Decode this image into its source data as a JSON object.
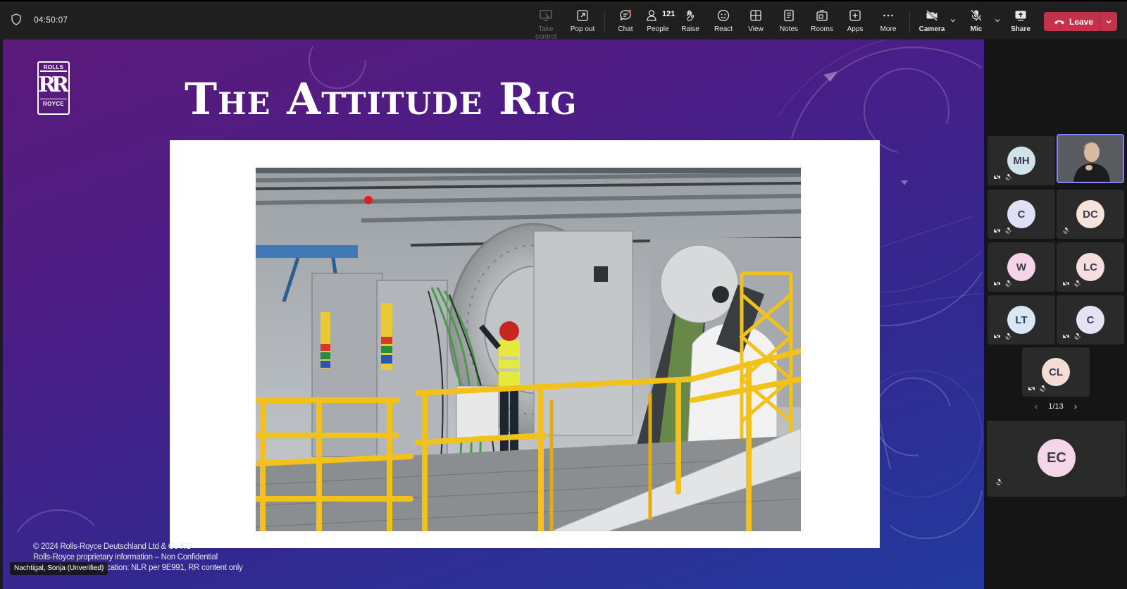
{
  "meeting": {
    "timer": "04:50:07"
  },
  "toolbar": {
    "take_control": "Take control",
    "pop_out": "Pop out",
    "chat": "Chat",
    "people": "People",
    "people_count": "121",
    "raise": "Raise",
    "react": "React",
    "view": "View",
    "notes": "Notes",
    "rooms": "Rooms",
    "apps": "Apps",
    "more": "More",
    "camera": "Camera",
    "mic": "Mic",
    "share": "Share",
    "leave": "Leave",
    "leave_color": "#c4314b"
  },
  "slide": {
    "logo_top": "ROLLS",
    "logo_mark": "RR",
    "logo_bottom": "ROYCE",
    "title": "The Attitude Rig",
    "footer": [
      "© 2024 Rolls-Royce Deutschland Ltd & Co KG",
      "Rolls-Royce proprietary information – Non Confidential",
      "Export Control classification: NLR per 9E991, RR content only"
    ],
    "presenter_label": "Nachtigal, Sonja (Unverified)"
  },
  "participants": {
    "tiles": [
      {
        "initials": "MH",
        "color": "#cfe3e8"
      },
      {
        "initials": "",
        "color": "#3a3a3a",
        "video": true
      },
      {
        "initials": "C",
        "color": "#e0e0f5"
      },
      {
        "initials": "DC",
        "color": "#f5e4dc"
      },
      {
        "initials": "W",
        "color": "#f6d3e9"
      },
      {
        "initials": "LC",
        "color": "#f6dede"
      },
      {
        "initials": "LT",
        "color": "#d8e6f6"
      },
      {
        "initials": "C",
        "color": "#e4e2f5"
      },
      {
        "initials": "CL",
        "color": "#f6dcd7"
      }
    ],
    "page": "1/13",
    "big_tile": {
      "initials": "EC",
      "color": "#f4d6e8"
    }
  }
}
